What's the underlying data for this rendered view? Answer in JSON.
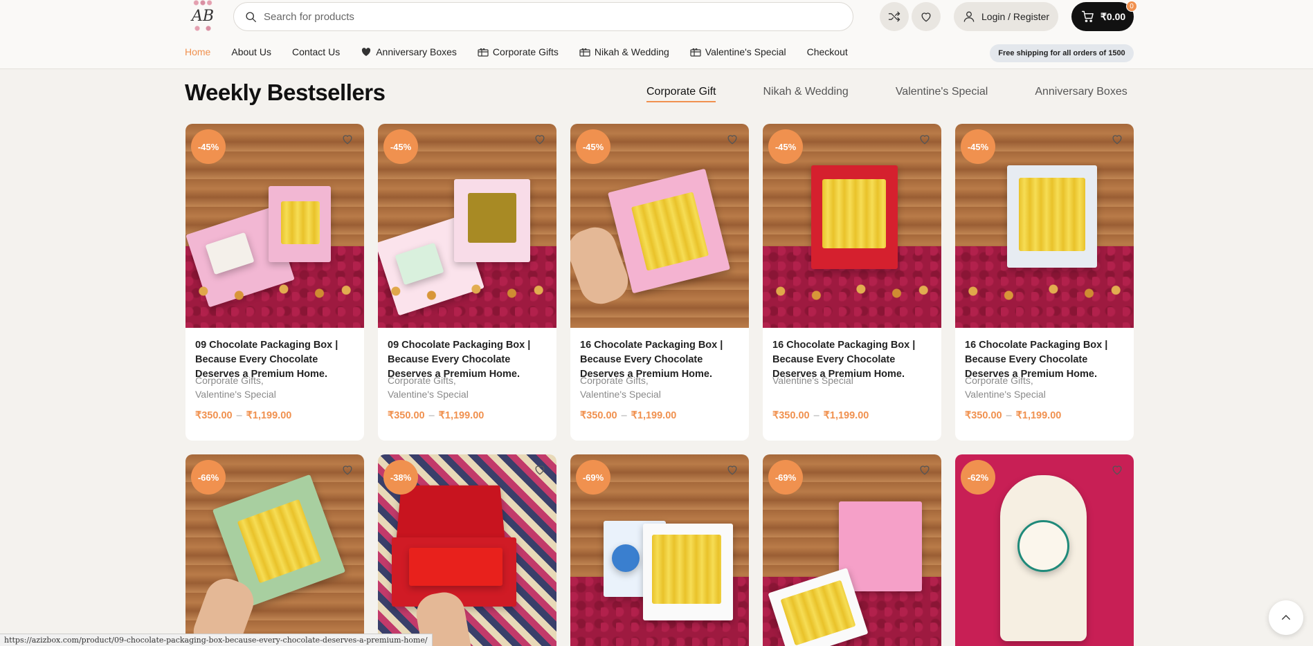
{
  "header": {
    "logo_text": "AB",
    "search_placeholder": "Search for products",
    "login_label": "Login / Register",
    "cart_total": "₹0.00",
    "cart_count": "0"
  },
  "nav": {
    "items": [
      {
        "label": "Home"
      },
      {
        "label": "About Us"
      },
      {
        "label": "Contact Us"
      },
      {
        "label": "Anniversary Boxes"
      },
      {
        "label": "Corporate Gifts"
      },
      {
        "label": "Nikah & Wedding"
      },
      {
        "label": "Valentine's Special"
      },
      {
        "label": "Checkout"
      }
    ],
    "shipping_note": "Free shipping for all orders of 1500"
  },
  "section": {
    "title": "Weekly Bestsellers",
    "tabs": [
      {
        "label": "Corporate Gift"
      },
      {
        "label": "Nikah & Wedding"
      },
      {
        "label": "Valentine's Special"
      },
      {
        "label": "Anniversary Boxes"
      }
    ]
  },
  "products": [
    {
      "discount": "-45%",
      "name": "09 Chocolate Packaging Box | Because Every Chocolate Deserves a Premium Home.",
      "cat1": "Corporate Gifts,",
      "cat2": "Valentine's Special",
      "price_min": "₹350.00",
      "price_max": "₹1,199.00"
    },
    {
      "discount": "-45%",
      "name": "09 Chocolate Packaging Box | Because Every Chocolate Deserves a Premium Home.",
      "cat1": "Corporate Gifts,",
      "cat2": "Valentine's Special",
      "price_min": "₹350.00",
      "price_max": "₹1,199.00"
    },
    {
      "discount": "-45%",
      "name": "16 Chocolate Packaging Box | Because Every Chocolate Deserves a Premium Home.",
      "cat1": "Corporate Gifts,",
      "cat2": "Valentine's Special",
      "price_min": "₹350.00",
      "price_max": "₹1,199.00"
    },
    {
      "discount": "-45%",
      "name": "16 Chocolate Packaging Box | Because Every Chocolate Deserves a Premium Home.",
      "cat1": "Valentine's Special",
      "cat2": "",
      "price_min": "₹350.00",
      "price_max": "₹1,199.00"
    },
    {
      "discount": "-45%",
      "name": "16 Chocolate Packaging Box | Because Every Chocolate Deserves a Premium Home.",
      "cat1": "Corporate Gifts,",
      "cat2": "Valentine's Special",
      "price_min": "₹350.00",
      "price_max": "₹1,199.00"
    },
    {
      "discount": "-66%"
    },
    {
      "discount": "-38%"
    },
    {
      "discount": "-69%"
    },
    {
      "discount": "-69%"
    },
    {
      "discount": "-62%"
    }
  ],
  "status_url": "https://azizbox.com/product/09-chocolate-packaging-box-because-every-chocolate-deserves-a-premium-home/",
  "colors": {
    "accent": "#f0914f",
    "background": "#f4f2ee",
    "cart_button": "#111111"
  },
  "icons": {
    "search": "search-icon",
    "compare": "shuffle-icon",
    "wishlist": "heart-icon",
    "user": "user-icon",
    "cart": "cart-icon",
    "scroll_top": "chevron-up-icon"
  }
}
